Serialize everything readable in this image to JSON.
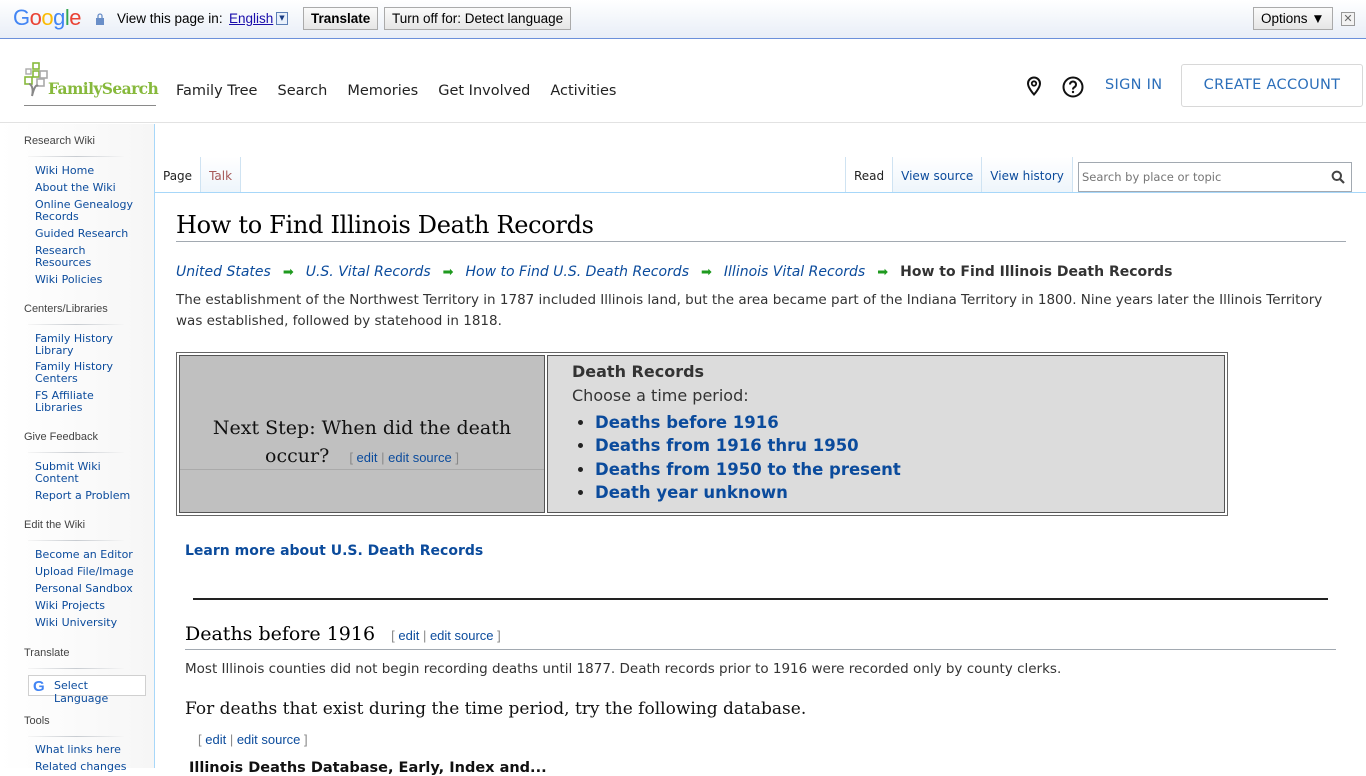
{
  "translate_bar": {
    "brand": "Google",
    "view_label": "View this page in:",
    "language": "English",
    "translate_button": "Translate",
    "turn_off_button": "Turn off for: Detect language",
    "options_button": "Options ▼",
    "close": "✕"
  },
  "header": {
    "logo_text": "FamilySearch",
    "nav": [
      "Family Tree",
      "Search",
      "Memories",
      "Get Involved",
      "Activities"
    ],
    "sign_in": "SIGN IN",
    "create_account": "CREATE ACCOUNT",
    "icons": [
      "location-pin-icon",
      "help-icon"
    ]
  },
  "sidebar": {
    "groups": [
      {
        "title": "Research Wiki",
        "items": [
          "Wiki Home",
          "About the Wiki",
          "Online Genealogy Records",
          "Guided Research",
          "Research Resources",
          "Wiki Policies"
        ]
      },
      {
        "title": "Centers/Libraries",
        "items": [
          "Family History Library",
          "Family History Centers",
          "FS Affiliate Libraries"
        ]
      },
      {
        "title": "Give Feedback",
        "items": [
          "Submit Wiki Content",
          "Report a Problem"
        ]
      },
      {
        "title": "Edit the Wiki",
        "items": [
          "Become an Editor",
          "Upload File/Image",
          "Personal Sandbox",
          "Wiki Projects",
          "Wiki University"
        ]
      },
      {
        "title": "Translate",
        "select_language": "Select Language"
      },
      {
        "title": "Tools",
        "items": [
          "What links here",
          "Related changes"
        ]
      }
    ]
  },
  "tabs": {
    "left": [
      "Page",
      "Talk"
    ],
    "right": [
      "Read",
      "View source",
      "View history"
    ],
    "search_placeholder": "Search by place or topic"
  },
  "content": {
    "title": "How to Find Illinois Death Records",
    "breadcrumbs": [
      "United States",
      "U.S. Vital Records",
      "How to Find U.S. Death Records",
      "Illinois Vital Records"
    ],
    "breadcrumb_current": "How to Find Illinois Death Records",
    "intro": "The establishment of the Northwest Territory in 1787 included Illinois land, but the area became part of the Indiana Territory in 1800. Nine years later the Illinois Territory was established, followed by statehood in 1818.",
    "next_step": "Next Step: When did the death occur?",
    "edit": "edit",
    "edit_source": "edit source",
    "box_heading": "Death Records",
    "box_sub": "Choose a time period:",
    "periods": [
      "Deaths before 1916",
      "Deaths from 1916 thru 1950",
      "Deaths from 1950 to the present",
      "Death year unknown"
    ],
    "learn_more": "Learn more about U.S. Death Records",
    "section_title": "Deaths before 1916",
    "section_text": "Most Illinois counties did not begin recording deaths until 1877. Death records prior to 1916 were recorded only by county clerks.",
    "database_text": "For deaths that exist during the time period, try the following database.",
    "database_title_partial": "Illinois Deaths Database, Early, Index and..."
  }
}
